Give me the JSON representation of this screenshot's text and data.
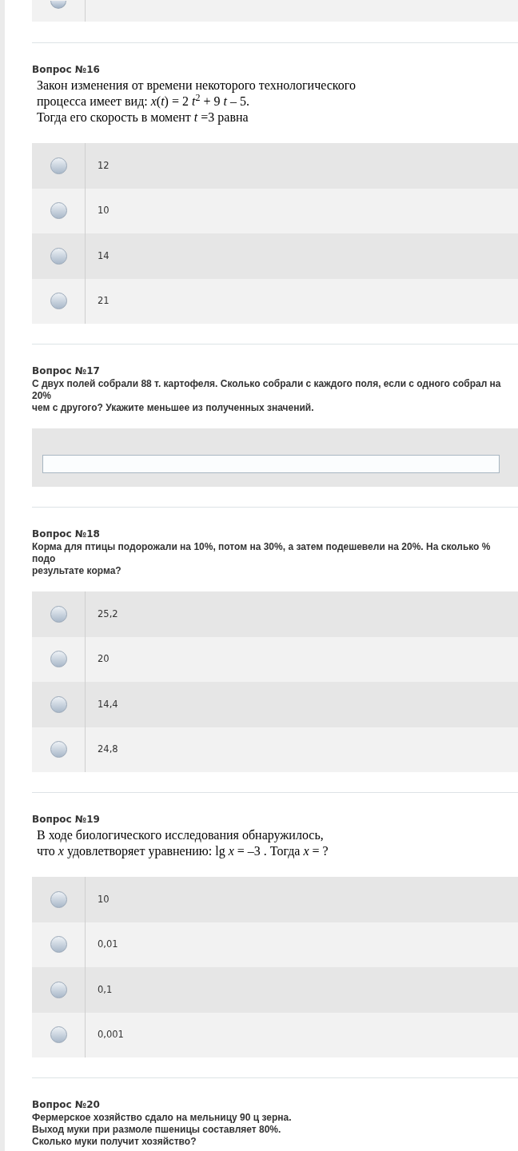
{
  "previous_answer_row": {
    "selected": false
  },
  "questions": [
    {
      "title": "Вопрос №16",
      "kind": "formula_choice",
      "text": "Закон изменения от времени некоторого технологического\nпроцесса имеет вид: *x*(*t*) = 2 *t*$^{2}$ + 9 *t* – 5.\nТогда его скорость в момент *t* =3 равна",
      "options": [
        {
          "text": "12",
          "selected": false
        },
        {
          "text": "10",
          "selected": false
        },
        {
          "text": "14",
          "selected": false
        },
        {
          "text": "21",
          "selected": false
        }
      ]
    },
    {
      "title": "Вопрос №17",
      "kind": "input",
      "text": "С двух полей собрали 88 т. картофеля. Сколько собрали с каждого поля, если с одного собрал на 20%\nчем с другого? Укажите меньшее из полученных значений."
    },
    {
      "title": "Вопрос №18",
      "kind": "choice",
      "text": "Корма для птицы подорожали на 10%, потом на 30%, а затем подешевели на 20%. На сколько % подо\nрезультате корма?",
      "options": [
        {
          "text": "25,2",
          "selected": false
        },
        {
          "text": "20",
          "selected": false
        },
        {
          "text": "14,4",
          "selected": false
        },
        {
          "text": "24,8",
          "selected": false
        }
      ]
    },
    {
      "title": "Вопрос №19",
      "kind": "formula_choice",
      "text": "В ходе биологического исследования обнаружилось,\nчто *x* удовлетворяет уравнению:  lg *x* = –3 . Тогда *x* = ?",
      "options": [
        {
          "text": "10",
          "selected": false
        },
        {
          "text": "0,01",
          "selected": false
        },
        {
          "text": "0,1",
          "selected": false
        },
        {
          "text": "0,001",
          "selected": false
        }
      ]
    },
    {
      "title": "Вопрос №20",
      "kind": "choice",
      "text": "Фермерское хозяйство сдало на мельницу 90 ц зерна.\nВыход муки при размоле пшеницы составляет 80%.\nСколько муки получит хозяйство?"
    }
  ]
}
